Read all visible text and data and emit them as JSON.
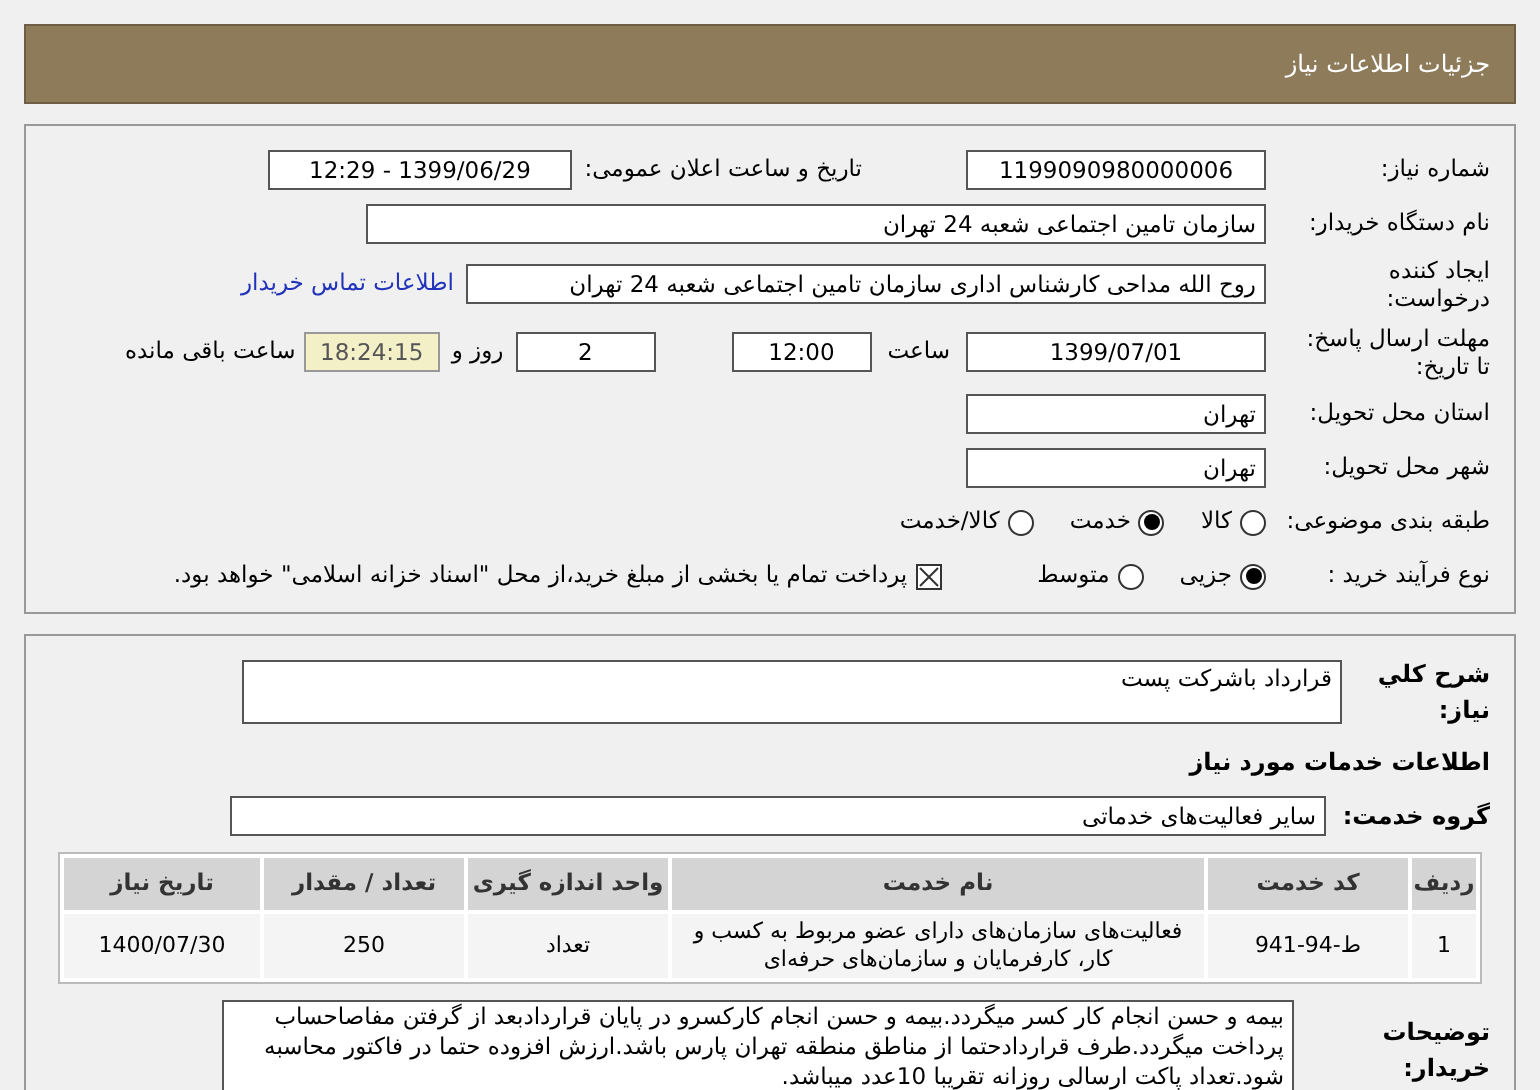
{
  "header": {
    "title": "جزئیات اطلاعات نیاز"
  },
  "need_number": {
    "label": "شماره نیاز:",
    "value": "1199090980000006"
  },
  "announce": {
    "label": "تاریخ و ساعت اعلان عمومی:",
    "value": "1399/06/29 - 12:29"
  },
  "buyer": {
    "label": "نام دستگاه خریدار:",
    "value": "سازمان تامین اجتماعی شعبه 24 تهران"
  },
  "creator": {
    "label_lines": [
      "ایجاد کننده",
      "درخواست:"
    ],
    "value": "روح الله  مداحی کارشناس اداری سازمان تامین اجتماعی شعبه 24 تهران",
    "link": "اطلاعات تماس خریدار"
  },
  "deadline": {
    "label_lines": [
      "مهلت ارسال پاسخ:",
      "تا تاریخ:"
    ],
    "date": "1399/07/01",
    "time_label": "ساعت",
    "time": "12:00",
    "days": "2",
    "days_label": "روز و",
    "remaining": "18:24:15",
    "remaining_label": "ساعت باقی مانده"
  },
  "province": {
    "label": "استان محل تحویل:",
    "value": "تهران"
  },
  "city": {
    "label": "شهر محل تحویل:",
    "value": "تهران"
  },
  "category": {
    "label": "طبقه بندی موضوعی:",
    "options": [
      {
        "label": "کالا",
        "selected": false
      },
      {
        "label": "خدمت",
        "selected": true
      },
      {
        "label": "کالا/خدمت",
        "selected": false
      }
    ]
  },
  "process": {
    "label": "نوع فرآیند خرید :",
    "options": [
      {
        "label": "جزیی",
        "selected": true
      },
      {
        "label": "متوسط",
        "selected": false
      }
    ],
    "payment": {
      "checked": true,
      "text": "پرداخت تمام یا بخشی از مبلغ خرید،از محل \"اسناد خزانه اسلامی\" خواهد بود."
    }
  },
  "summary": {
    "label": "شرح کلي نياز:",
    "value": "قرارداد باشرکت پست"
  },
  "services_heading": "اطلاعات خدمات مورد نیاز",
  "service_group": {
    "label": "گروه خدمت:",
    "value": "سایر فعالیت‌های خدماتی"
  },
  "table": {
    "columns": [
      "ردیف",
      "کد خدمت",
      "نام خدمت",
      "واحد اندازه گیری",
      "تعداد / مقدار",
      "تاریخ نیاز"
    ],
    "rows": [
      [
        "1",
        "ط-94-941",
        "فعالیت‌های سازمان‌های دارای عضو مربوط به کسب و کار، کارفرمایان و سازمان‌های حرفه‌ای",
        "تعداد",
        "250",
        "1400/07/30"
      ]
    ]
  },
  "buyer_notes": {
    "label": "توضیحات خریدار:",
    "value": "بیمه و حسن انجام کار کسر میگردد.بیمه و حسن انجام کارکسرو در پایان قراردادبعد از گرفتن مفاصاحساب پرداخت میگردد.طرف قراردادحتما از مناطق منطقه تهران پارس باشد.ارزش افزوده حتما در فاکتور محاسبه شود.تعداد پاکت ارسالی روزانه تقریبا 10عدد میباشد."
  }
}
